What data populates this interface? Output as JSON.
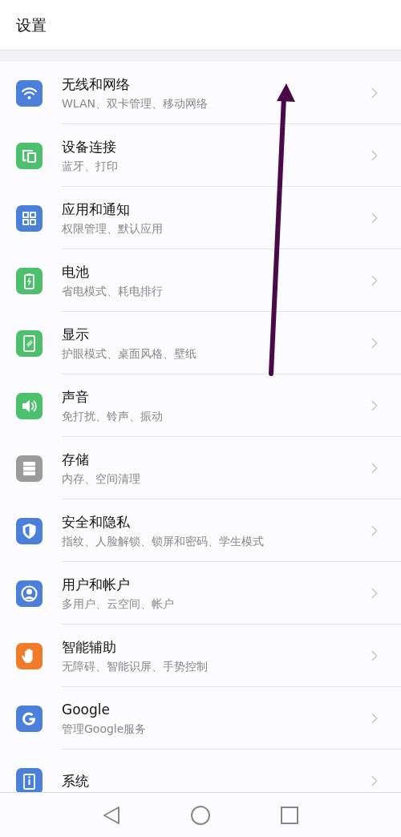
{
  "header": {
    "title": "设置"
  },
  "items": [
    {
      "kind": "wifi",
      "title": "无线和网络",
      "subtitle": "WLAN、双卡管理、移动网络"
    },
    {
      "kind": "devices",
      "title": "设备连接",
      "subtitle": "蓝牙、打印"
    },
    {
      "kind": "apps",
      "title": "应用和通知",
      "subtitle": "权限管理、默认应用"
    },
    {
      "kind": "battery",
      "title": "电池",
      "subtitle": "省电模式、耗电排行"
    },
    {
      "kind": "display",
      "title": "显示",
      "subtitle": "护眼模式、桌面风格、壁纸"
    },
    {
      "kind": "sound",
      "title": "声音",
      "subtitle": "免打扰、铃声、振动"
    },
    {
      "kind": "storage",
      "title": "存储",
      "subtitle": "内存、空间清理"
    },
    {
      "kind": "security",
      "title": "安全和隐私",
      "subtitle": "指纹、人脸解锁、锁屏和密码、学生模式"
    },
    {
      "kind": "user",
      "title": "用户和帐户",
      "subtitle": "多用户、云空间、帐户"
    },
    {
      "kind": "assist",
      "title": "智能辅助",
      "subtitle": "无障碍、智能识屏、手势控制"
    },
    {
      "kind": "google",
      "title": "Google",
      "subtitle": "管理Google服务"
    },
    {
      "kind": "system",
      "title": "系统"
    }
  ]
}
